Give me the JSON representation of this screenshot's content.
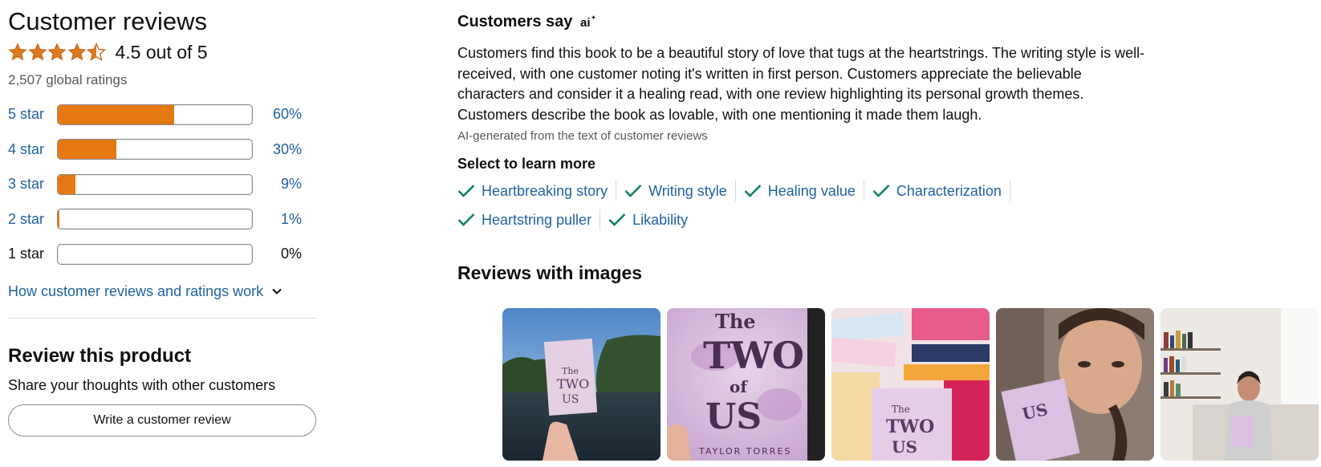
{
  "left": {
    "title": "Customer reviews",
    "average_stars": 4.5,
    "average_text": "4.5 out of 5",
    "global_ratings": "2,507 global ratings",
    "histogram": [
      {
        "label": "5 star",
        "percent": 60,
        "pct_text": "60%",
        "active": true
      },
      {
        "label": "4 star",
        "percent": 30,
        "pct_text": "30%",
        "active": true
      },
      {
        "label": "3 star",
        "percent": 9,
        "pct_text": "9%",
        "active": true
      },
      {
        "label": "2 star",
        "percent": 1,
        "pct_text": "1%",
        "active": true
      },
      {
        "label": "1 star",
        "percent": 0,
        "pct_text": "0%",
        "active": false
      }
    ],
    "how_link": "How customer reviews and ratings work",
    "review_title": "Review this product",
    "review_sub": "Share your thoughts with other customers",
    "write_button": "Write a customer review"
  },
  "right": {
    "customers_say": "Customers say",
    "ai_icon": "ai-sparkle-icon",
    "summary": "Customers find this book to be a beautiful story of love that tugs at the heartstrings. The writing style is well-received, with one customer noting it's written in first person. Customers appreciate the believable characters and consider it a healing read, with one review highlighting its personal growth themes. Customers describe the book as lovable, with one mentioning it made them laugh.",
    "ai_note": "AI-generated from the text of customer reviews",
    "select_label": "Select to learn more",
    "aspects": [
      "Heartbreaking story",
      "Writing style",
      "Healing value",
      "Characterization",
      "Heartstring puller",
      "Likability"
    ],
    "reviews_with_images": "Reviews with images",
    "images": [
      {
        "name": "review-image-1",
        "desc": "book held up over lake"
      },
      {
        "name": "review-image-2",
        "desc": "book cover close-up"
      },
      {
        "name": "review-image-3",
        "desc": "stack of books"
      },
      {
        "name": "review-image-4",
        "desc": "selfie with book"
      },
      {
        "name": "review-image-5",
        "desc": "reading in living room"
      }
    ],
    "cover_text": {
      "line1": "The",
      "line2": "TWO",
      "line3": "of",
      "line4": "US",
      "author": "TAYLOR TORRES"
    }
  },
  "colors": {
    "star": "#de7921",
    "bar_fill": "#e47911",
    "link": "#2162a1",
    "check": "#067d62",
    "text": "#0f1111",
    "muted": "#565959"
  }
}
